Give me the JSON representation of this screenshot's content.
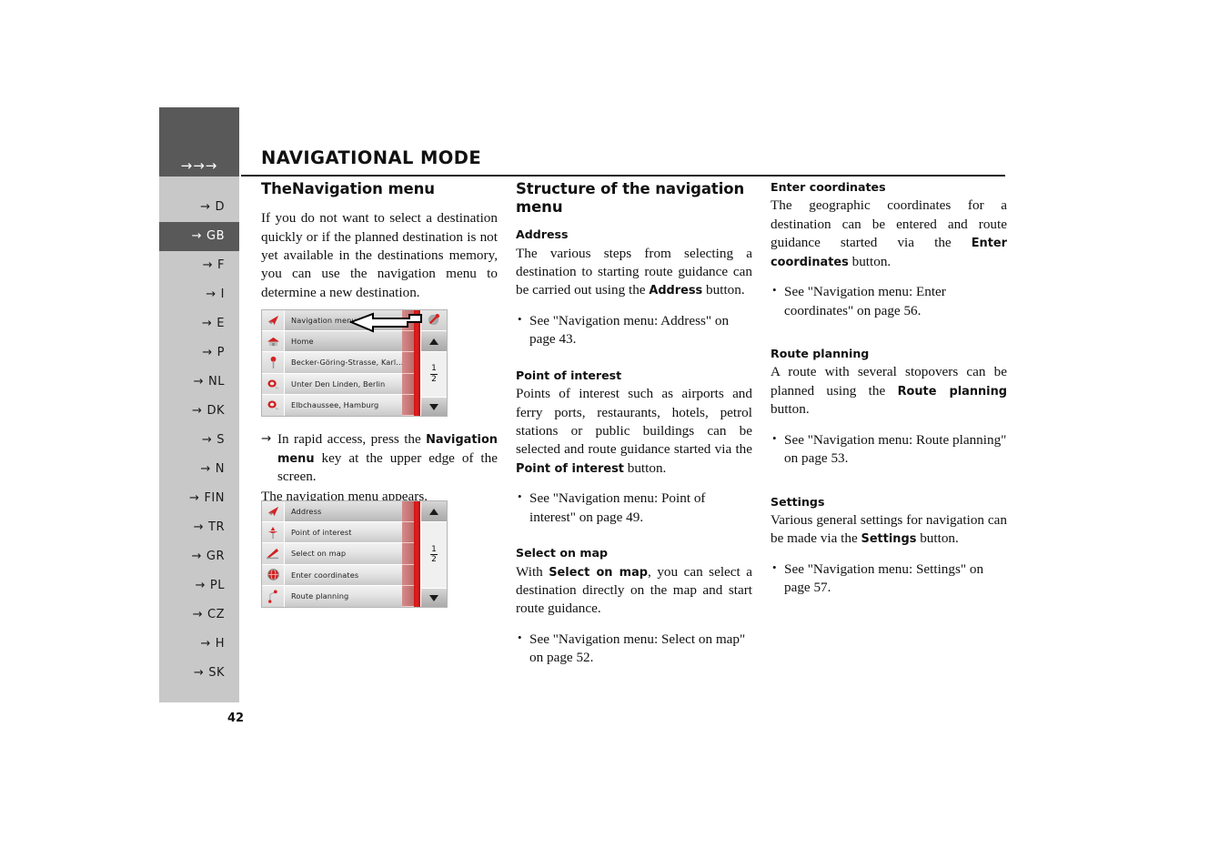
{
  "header": {
    "arrows": "→→→",
    "title": "NAVIGATIONAL MODE"
  },
  "page_number": "42",
  "sidebar": {
    "items": [
      {
        "label": "D",
        "active": false
      },
      {
        "label": "GB",
        "active": true
      },
      {
        "label": "F",
        "active": false
      },
      {
        "label": "I",
        "active": false
      },
      {
        "label": "E",
        "active": false
      },
      {
        "label": "P",
        "active": false
      },
      {
        "label": "NL",
        "active": false
      },
      {
        "label": "DK",
        "active": false
      },
      {
        "label": "S",
        "active": false
      },
      {
        "label": "N",
        "active": false
      },
      {
        "label": "FIN",
        "active": false
      },
      {
        "label": "TR",
        "active": false
      },
      {
        "label": "GR",
        "active": false
      },
      {
        "label": "PL",
        "active": false
      },
      {
        "label": "CZ",
        "active": false
      },
      {
        "label": "H",
        "active": false
      },
      {
        "label": "SK",
        "active": false
      }
    ]
  },
  "column1": {
    "heading": "TheNavigation menu",
    "intro": "If you do not want to select a destination quickly or if the planned destination is not yet available in the destinations memory, you can use the navigation menu to determine a new destination.",
    "step_prefix": "In rapid access, press the ",
    "step_bold": "Navigation menu",
    "step_suffix": " key at the upper edge of the screen.",
    "step_result": "The navigation menu appears."
  },
  "column2": {
    "heading": "Structure of the navigation menu",
    "address": {
      "title": "Address",
      "text_1": "The various steps from selecting a destination to starting route guidance can be carried out using the ",
      "text_bold": "Address",
      "text_2": " button.",
      "bullet": "See \"Navigation menu: Address\" on page 43."
    },
    "poi": {
      "title": "Point of interest",
      "text_1": "Points of interest such as airports and ferry ports, restaurants, hotels, petrol stations or public buildings can be selected and route guidance started via the ",
      "text_bold": "Point of interest",
      "text_2": " button.",
      "bullet": "See \"Navigation menu: Point of interest\" on page 49."
    },
    "select_on_map": {
      "title": "Select on map",
      "text_1": "With ",
      "text_bold": "Select on map",
      "text_2": ", you can select a destination directly on the map and start route guidance.",
      "bullet": "See \"Navigation menu: Select on map\" on page 52."
    }
  },
  "column3": {
    "enter_coordinates": {
      "title": "Enter coordinates",
      "text_1": "The geographic coordinates for a destination can be entered and route guidance started via the ",
      "text_bold": "Enter coordinates",
      "text_2": " button.",
      "bullet": "See \"Navigation menu: Enter coordinates\" on page 56."
    },
    "route_planning": {
      "title": "Route planning",
      "text_1": "A route with several stopovers can be planned using the ",
      "text_bold": "Route planning",
      "text_2": " button.",
      "bullet": "See \"Navigation menu: Route planning\" on page 53."
    },
    "settings": {
      "title": "Settings",
      "text_1": "Various general settings for navigation can be made via the ",
      "text_bold": "Settings",
      "text_2": " button.",
      "bullet": "See \"Navigation menu: Settings\" on page 57."
    }
  },
  "device_1": {
    "rows": [
      {
        "label": "Navigation menu",
        "icon": "navigation-arrow-icon"
      },
      {
        "label": "Home",
        "icon": "house-icon"
      },
      {
        "label": "Becker-Göring-Strasse, Karl...",
        "icon": "pin-icon"
      },
      {
        "label": "Unter Den Linden, Berlin",
        "icon": "destination-flag-icon"
      },
      {
        "label": "Elbchaussee, Hamburg",
        "icon": "destination-flag-icon"
      }
    ],
    "pager": {
      "current": "1",
      "total": "2",
      "up": "▲",
      "down": "▼"
    },
    "corner_icon": "map-pin-icon"
  },
  "device_2": {
    "rows": [
      {
        "label": "Address",
        "icon": "navigation-arrow-icon"
      },
      {
        "label": "Point of interest",
        "icon": "poi-pin-icon"
      },
      {
        "label": "Select on map",
        "icon": "map-icon"
      },
      {
        "label": "Enter coordinates",
        "icon": "globe-icon"
      },
      {
        "label": "Route planning",
        "icon": "route-icon"
      }
    ],
    "pager": {
      "current": "1",
      "total": "2",
      "up": "▲",
      "down": "▼"
    }
  },
  "colors": {
    "sidebar_bg": "#c8c8c8",
    "sidebar_active": "#595959",
    "header_block": "#595959",
    "accent_red": "#e21f1f",
    "text": "#111111"
  }
}
